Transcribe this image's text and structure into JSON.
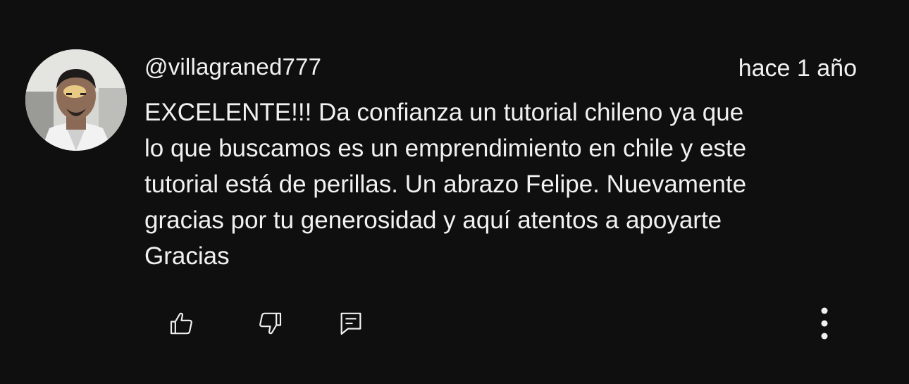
{
  "comment": {
    "author": "@villagraned777",
    "timestamp": "hace 1 año",
    "text_lines": [
      "EXCELENTE!!! Da confianza un tutorial chileno ya que",
      "lo que buscamos es un emprendimiento en chile y este",
      "tutorial está de perillas. Un abrazo Felipe. Nuevamente",
      "gracias por tu generosidad y aquí atentos a apoyarte",
      "Gracias"
    ]
  },
  "actions": {
    "like_icon": "thumbs-up-icon",
    "dislike_icon": "thumbs-down-icon",
    "reply_icon": "reply-comment-icon",
    "more_icon": "more-vertical-icon"
  },
  "colors": {
    "background": "#0f0f0f",
    "text": "#f1f1f1"
  }
}
